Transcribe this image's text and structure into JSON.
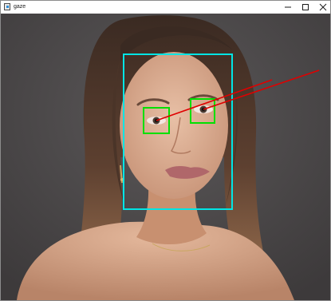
{
  "window": {
    "title": "gaze"
  },
  "titlebar_buttons": {
    "minimize": "minimize-icon",
    "maximize": "maximize-icon",
    "close": "close-icon"
  },
  "overlay_colors": {
    "face_box": "#00e5e5",
    "eye_box": "#00e000",
    "gaze_line": "#e00000"
  }
}
